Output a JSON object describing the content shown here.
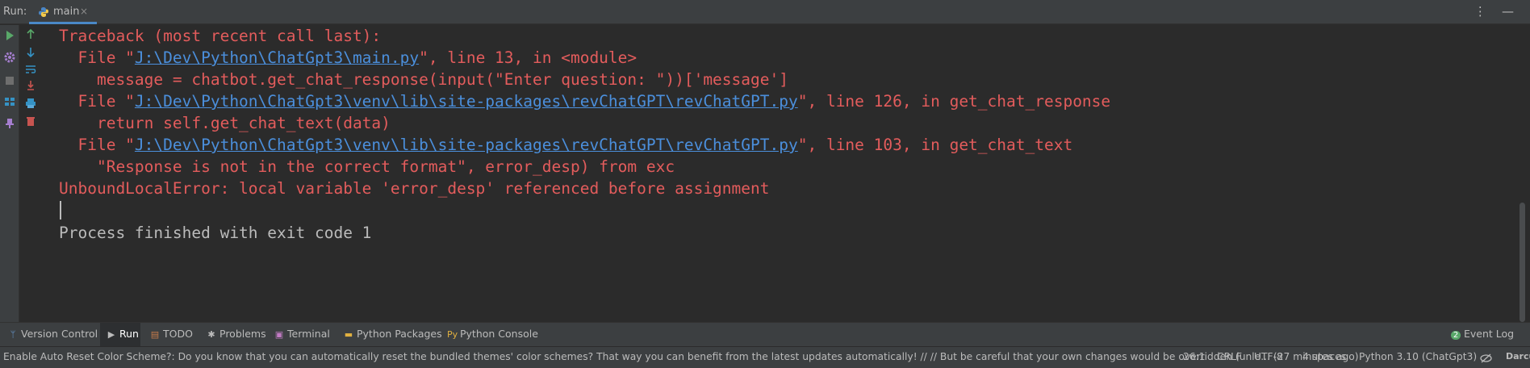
{
  "run_panel": {
    "label": "Run:",
    "tab": {
      "name": "main",
      "close": "×"
    },
    "actions": {
      "more": "⋮",
      "minimize": "—"
    }
  },
  "console": {
    "lines": [
      {
        "t1": "Traceback (most recent call last):"
      },
      {
        "t1": "  File \"",
        "link": "J:\\Dev\\Python\\ChatGpt3\\main.py",
        "t2": "\", line 13, in <module>"
      },
      {
        "t1": "    message = chatbot.get_chat_response(input(\"Enter question: \"))['message']"
      },
      {
        "t1": "  File \"",
        "link": "J:\\Dev\\Python\\ChatGpt3\\venv\\lib\\site-packages\\revChatGPT\\revChatGPT.py",
        "t2": "\", line 126, in get_chat_response"
      },
      {
        "t1": "    return self.get_chat_text(data)"
      },
      {
        "t1": "  File \"",
        "link": "J:\\Dev\\Python\\ChatGpt3\\venv\\lib\\site-packages\\revChatGPT\\revChatGPT.py",
        "t2": "\", line 103, in get_chat_text"
      },
      {
        "t1": "    \"Response is not in the correct format\", error_desp) from exc"
      },
      {
        "t1": "UnboundLocalError: local variable 'error_desp' referenced before assignment"
      }
    ],
    "process_message": "Process finished with exit code 1"
  },
  "toolwindows": {
    "version_control": "Version Control",
    "run": "Run",
    "todo": "TODO",
    "problems": "Problems",
    "terminal": "Terminal",
    "python_packages": "Python Packages",
    "python_console": "Python Console",
    "event_log_count": "2",
    "event_log": "Event Log"
  },
  "statusbar": {
    "message": "Enable Auto Reset Color Scheme?: Do you know that you can automatically reset the bundled themes' color schemes? That way you can benefit from the latest updates automatically! // // But be careful that your own changes would be overridden (unle... (27 minutes ago)",
    "position": "26:1",
    "line_separator": "CRLF",
    "encoding": "UTF-8",
    "indent": "4 spaces",
    "interpreter": "Python 3.10 (ChatGpt3)",
    "theme": "Darcula"
  },
  "colors": {
    "error_text": "#e35c5c",
    "link": "#4b8fdc",
    "background": "#2b2b2b",
    "panel": "#3c3f41",
    "run_green": "#59a869"
  },
  "icons": {
    "left_toolbar": [
      "run-icon",
      "settings-icon",
      "stop-icon",
      "layout-icon",
      "pin-icon"
    ],
    "second_toolbar": [
      "up-arrow-icon",
      "down-arrow-icon",
      "soft-wrap-icon",
      "scroll-to-end-icon",
      "print-icon",
      "trash-icon"
    ]
  }
}
